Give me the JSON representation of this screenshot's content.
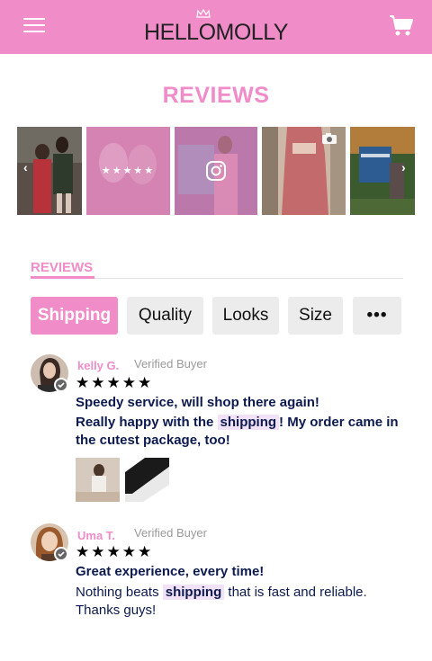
{
  "header": {
    "logo": "HELLOMOLLY",
    "menu_icon": "hamburger-menu-icon",
    "cart_icon": "shopping-cart-icon",
    "brand_color": "#f08cc8"
  },
  "page": {
    "title": "REVIEWS"
  },
  "gallery": {
    "prev_glyph": "‹",
    "next_glyph": "›",
    "overlay_stars": "★★★★★"
  },
  "reviews_section": {
    "tab_label": "REVIEWS",
    "filters": [
      "Shipping",
      "Quality",
      "Looks",
      "Size",
      "•••"
    ],
    "active_filter": "Shipping"
  },
  "reviews": [
    {
      "name": "kelly G.",
      "verified": "Verified Buyer",
      "stars": "★★★★★",
      "rating": 5,
      "title": "Speedy service, will shop there again!",
      "body_before": "Really happy with the",
      "body_highlight": "shipping",
      "body_after": "!  My order came in the cutest package, too!"
    },
    {
      "name": "Uma T.",
      "verified": "Verified Buyer",
      "stars": "★★★★★",
      "rating": 5,
      "title": "Great experience, every time!",
      "body_before": "Nothing beats",
      "body_highlight": "shipping",
      "body_after": " that is fast and reliable. Thanks guys!"
    }
  ]
}
